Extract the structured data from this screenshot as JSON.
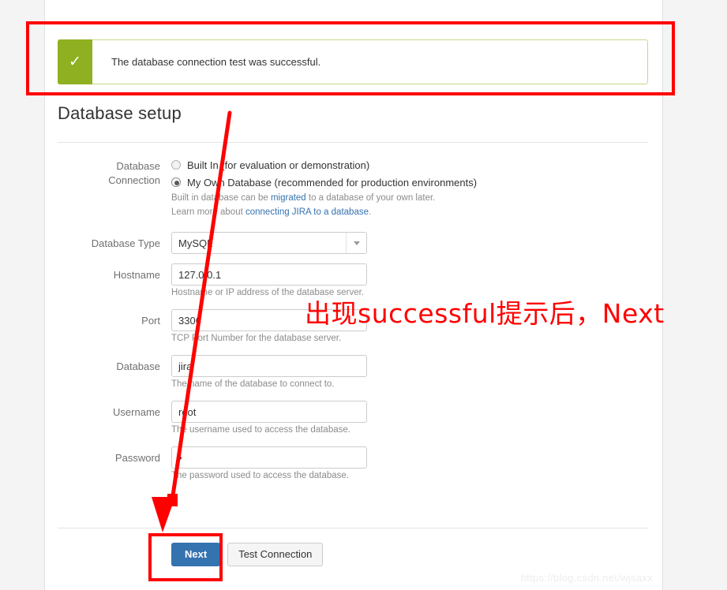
{
  "window": {
    "background_color": "#f4f4f4",
    "card_background": "#ffffff"
  },
  "banner": {
    "icon": "check-icon",
    "icon_glyph": "✓",
    "message": "The database connection test was successful.",
    "accent_color": "#8eb021",
    "border_color": "#c3d98a"
  },
  "page": {
    "title": "Database setup"
  },
  "form": {
    "connection": {
      "label_line1": "Database",
      "label_line2": "Connection",
      "options": [
        {
          "label": "Built In (for evaluation or demonstration)",
          "selected": false
        },
        {
          "label": "My Own Database (recommended for production environments)",
          "selected": true
        }
      ],
      "help_1_prefix": "Built in database can be ",
      "help_1_link": "migrated",
      "help_1_suffix": " to a database of your own later.",
      "help_2_prefix": "Learn more about ",
      "help_2_link": "connecting JIRA to a database",
      "help_2_suffix": "."
    },
    "fields": [
      {
        "name": "database-type",
        "label": "Database Type",
        "type": "select",
        "value": "MySQL",
        "help": ""
      },
      {
        "name": "hostname",
        "label": "Hostname",
        "type": "text",
        "value": "127.0.0.1",
        "help": "Hostname or IP address of the database server."
      },
      {
        "name": "port",
        "label": "Port",
        "type": "text",
        "value": "3306",
        "help": "TCP Port Number for the database server."
      },
      {
        "name": "database",
        "label": "Database",
        "type": "text",
        "value": "jira",
        "help": "The name of the database to connect to."
      },
      {
        "name": "username",
        "label": "Username",
        "type": "text",
        "value": "root",
        "help": "The username used to access the database."
      },
      {
        "name": "password",
        "label": "Password",
        "type": "password",
        "value": "•",
        "help": "The password used to access the database."
      }
    ]
  },
  "buttons": {
    "next": "Next",
    "test_connection": "Test Connection",
    "next_color": "#3572b0"
  },
  "annotations": {
    "color": "#ff0000",
    "note_text": "出现successful提示后，Next",
    "boxes": [
      "banner-highlight",
      "next-button-highlight"
    ],
    "arrow": "downward-arrow"
  },
  "watermark": {
    "text": "https://blog.csdn.net/wjsaxx"
  }
}
